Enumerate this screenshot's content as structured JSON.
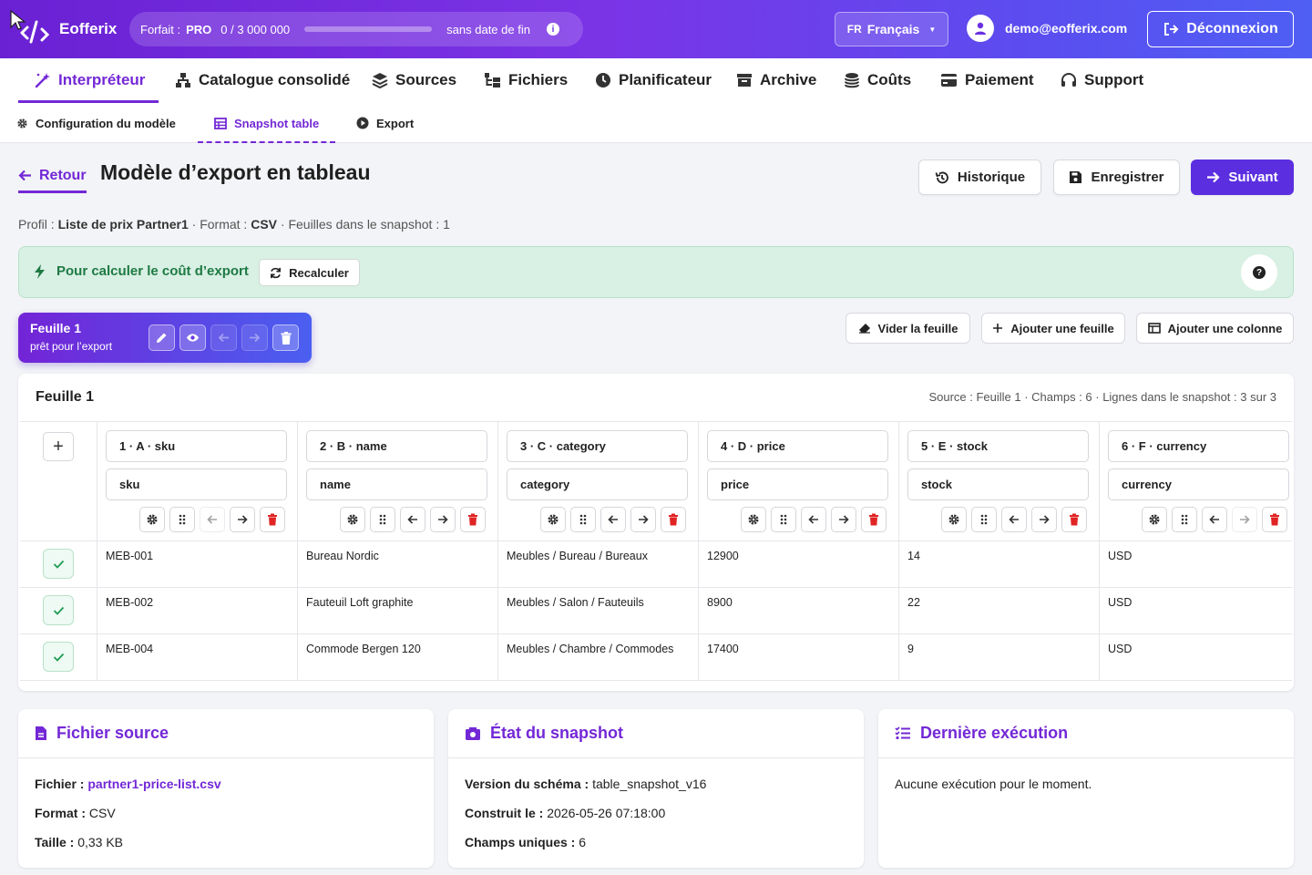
{
  "topbar": {
    "brand": "Eofferix",
    "plan": {
      "label": "Forfait :",
      "tier": "PRO",
      "usage": "0 / 3 000 000",
      "usage_fraction": 0.0,
      "expiry": "sans date de fin"
    },
    "lang": {
      "code": "FR",
      "label": "Français"
    },
    "user_email": "demo@eofferix.com",
    "logout": "Déconnexion"
  },
  "nav": [
    {
      "label": "Interpréteur",
      "icon": "magic-wand-icon",
      "active": true
    },
    {
      "label": "Catalogue consolidé",
      "icon": "network-icon"
    },
    {
      "label": "Sources",
      "icon": "layers-icon"
    },
    {
      "label": "Fichiers",
      "icon": "folder-tree-icon"
    },
    {
      "label": "Planificateur",
      "icon": "clock-icon"
    },
    {
      "label": "Archive",
      "icon": "archive-box-icon"
    },
    {
      "label": "Coûts",
      "icon": "coins-icon"
    },
    {
      "label": "Paiement",
      "icon": "credit-card-icon"
    },
    {
      "label": "Support",
      "icon": "headset-icon"
    }
  ],
  "subnav": [
    {
      "label": "Configuration du modèle",
      "icon": "gear-icon"
    },
    {
      "label": "Snapshot table",
      "icon": "table-icon",
      "active": true
    },
    {
      "label": "Export",
      "icon": "play-circle-icon"
    }
  ],
  "page": {
    "back": "Retour",
    "title": "Modèle d’export en tableau",
    "history": "Historique",
    "save": "Enregistrer",
    "next": "Suivant",
    "meta": {
      "profile_label": "Profil :",
      "profile": "Liste de prix Partner1",
      "format_label": "· Format :",
      "format": "CSV",
      "sheets": "· Feuilles dans le snapshot : 1"
    }
  },
  "calc": {
    "text": "Pour calculer le coût d’export",
    "button": "Recalculer"
  },
  "sheet_tab": {
    "name": "Feuille 1",
    "status": "prêt pour l’export"
  },
  "sheet_actions": {
    "clear": "Vider la feuille",
    "add_sheet": "Ajouter une feuille",
    "add_column": "Ajouter une colonne"
  },
  "table_card": {
    "title": "Feuille 1",
    "meta": "Source : Feuille 1 · Champs : 6 · Lignes dans le snapshot : 3 sur 3",
    "add_column_symbol": "+",
    "columns": [
      {
        "header": "1 · A · sku",
        "field": "sku"
      },
      {
        "header": "2 · B · name",
        "field": "name"
      },
      {
        "header": "3 · C · category",
        "field": "category"
      },
      {
        "header": "4 · D · price",
        "field": "price"
      },
      {
        "header": "5 · E · stock",
        "field": "stock"
      },
      {
        "header": "6 · F · currency",
        "field": "currency"
      }
    ],
    "rows": [
      [
        "MEB-001",
        "Bureau Nordic",
        "Meubles / Bureau / Bureaux",
        "12900",
        "14",
        "USD"
      ],
      [
        "MEB-002",
        "Fauteuil Loft graphite",
        "Meubles / Salon / Fauteuils",
        "8900",
        "22",
        "USD"
      ],
      [
        "MEB-004",
        "Commode Bergen 120",
        "Meubles / Chambre / Commodes",
        "17400",
        "9",
        "USD"
      ]
    ]
  },
  "source_card": {
    "title": "Fichier source",
    "file_label": "Fichier :",
    "file": "partner1-price-list.csv",
    "format_label": "Format :",
    "format": "CSV",
    "size_label": "Taille :",
    "size": "0,33 KB"
  },
  "snapshot_card": {
    "title": "État du snapshot",
    "schema_label": "Version du schéma :",
    "schema": "table_snapshot_v16",
    "built_label": "Construit le :",
    "built": "2026-05-26 07:18:00",
    "fields_label": "Champs uniques :",
    "fields": "6"
  },
  "run_card": {
    "title": "Dernière exécution",
    "text": "Aucune exécution pour le moment."
  },
  "colors": {
    "brand": "#7328d6",
    "primary": "#5b2fe0",
    "success": "#1e7a43",
    "danger": "#e02424"
  }
}
